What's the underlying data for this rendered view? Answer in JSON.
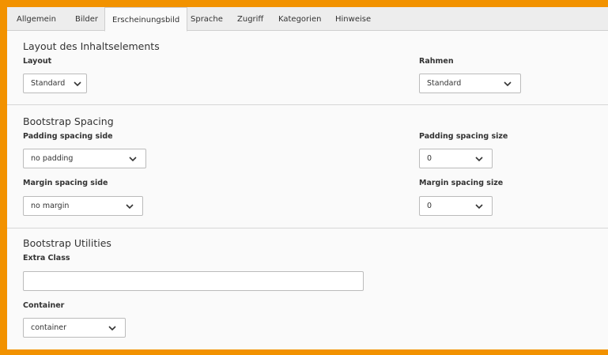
{
  "tabs": [
    {
      "label": "Allgemein",
      "active": false
    },
    {
      "label": "Bilder",
      "active": false
    },
    {
      "label": "Erscheinungsbild",
      "active": true
    },
    {
      "label": "Sprache",
      "active": false
    },
    {
      "label": "Zugriff",
      "active": false
    },
    {
      "label": "Kategorien",
      "active": false
    },
    {
      "label": "Hinweise",
      "active": false
    }
  ],
  "layout_section": {
    "title": "Layout des Inhaltselements",
    "layout": {
      "label": "Layout",
      "value": "Standard"
    },
    "rahmen": {
      "label": "Rahmen",
      "value": "Standard"
    }
  },
  "spacing_section": {
    "title": "Bootstrap Spacing",
    "padding_side": {
      "label": "Padding spacing side",
      "value": "no padding"
    },
    "padding_size": {
      "label": "Padding spacing size",
      "value": "0"
    },
    "margin_side": {
      "label": "Margin spacing side",
      "value": "no margin"
    },
    "margin_size": {
      "label": "Margin spacing size",
      "value": "0"
    }
  },
  "utilities_section": {
    "title": "Bootstrap Utilities",
    "extra_class": {
      "label": "Extra Class",
      "value": ""
    },
    "container": {
      "label": "Container",
      "value": "container"
    }
  },
  "colors": {
    "frame_border": "#f29200",
    "panel_background": "#fafafa",
    "tab_bar_background": "#ededed"
  },
  "icons": {
    "select_indicator": "chevron-down-icon"
  }
}
